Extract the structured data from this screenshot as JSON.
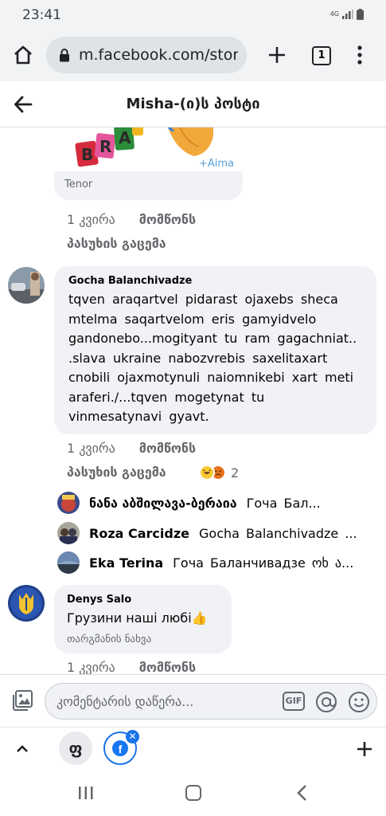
{
  "status_bar": {
    "time": "23:41",
    "network": "4G"
  },
  "browser": {
    "url": "m.facebook.com/stor",
    "tab_count": "1"
  },
  "header": {
    "title": "Misha-(ი)ს პოსტი"
  },
  "gif": {
    "source": "Tenor",
    "art_text": "+Aima"
  },
  "comments": [
    {
      "time": "1 კვირა",
      "like": "მომწონს",
      "reply": "პასუხის გაცემა"
    },
    {
      "author": "Gocha  Balanchivadze",
      "lines": [
        "tqven  araqartvel  pidarast  ojaxebs  sheca",
        "mtelma  saqartvelom  eris  gamyidvelo",
        "gandonebo...mogityant  tu  ram gagachniat..",
        ".slava  ukraine  nabozvrebis  saxelitaxart",
        "cnobili  ojaxmotynuli naiomnikebi  xart  meti",
        "araferi./...tqven mogetynat  tu",
        "vinmesatynavi  gyavt."
      ],
      "time": "1 კვირა",
      "like": "მომწონს",
      "reply": "პასუხის გაცემა",
      "reaction_count": "2"
    },
    {
      "author": "Denys Salo",
      "text": "Грузини наші любі👍",
      "translate": "თარგმანის ნახვა",
      "time": "1 კვირა",
      "like": "მომწონს"
    }
  ],
  "replies": [
    {
      "name": "ნანა აბშილავა-ბერაია",
      "snippet": "Гоча Бал..."
    },
    {
      "name": "Roza Carcidze",
      "snippet": "Gocha  Balanchivadze ..."
    },
    {
      "name": "Eka Terina",
      "snippet": "Гоча Баланчивадзе ოხ ა..."
    }
  ],
  "composer": {
    "placeholder": "კომენტარის დაწერა...",
    "gif_label": "GIF"
  },
  "tab_strip": {
    "tab1_letter": "ფ",
    "close_glyph": "✕"
  },
  "icons": [
    "home-icon",
    "lock-icon",
    "plus-icon",
    "menu-icon",
    "back-arrow-icon",
    "photo-icon",
    "mention-icon",
    "emoji-icon",
    "chevron-up-icon",
    "facebook-icon"
  ]
}
